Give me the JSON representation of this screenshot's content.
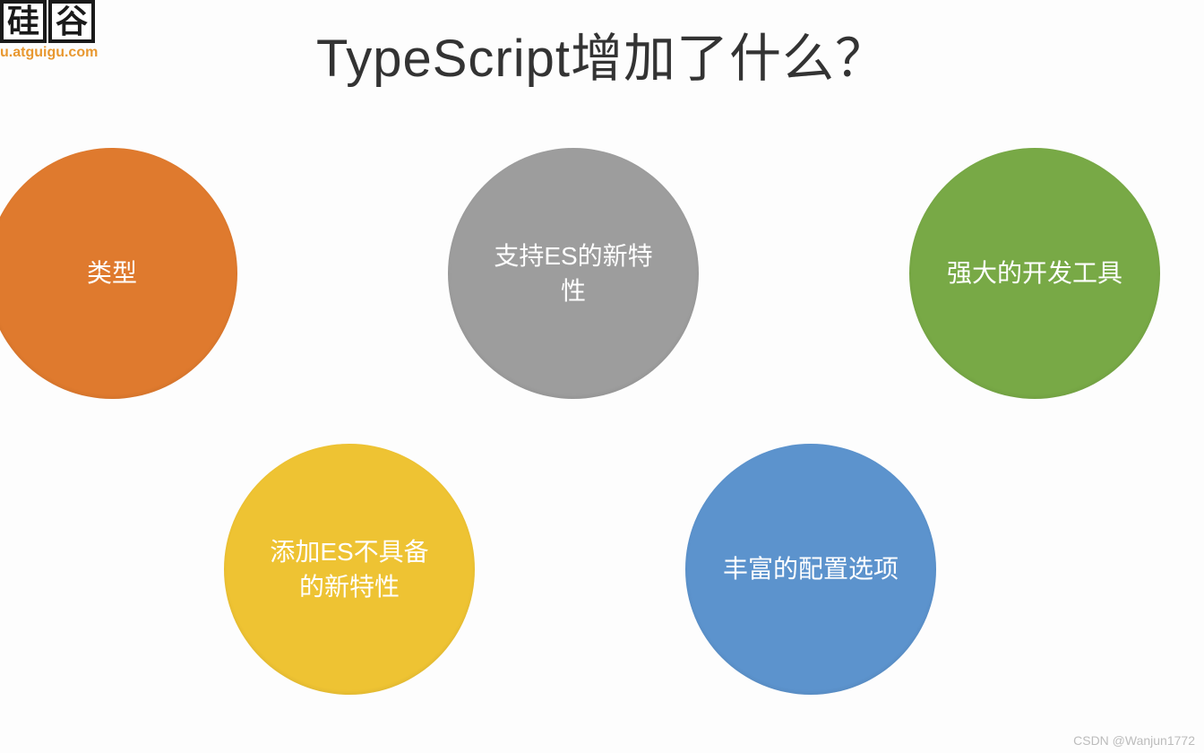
{
  "logo": {
    "char1": "硅",
    "char2": "谷",
    "url": "u.atguigu.com"
  },
  "title": "TypeScript增加了什么？",
  "circles": {
    "orange": "类型",
    "gray": "支持ES的新特性",
    "green": "强大的开发工具",
    "yellow": "添加ES不具备的新特性",
    "blue": "丰富的配置选项"
  },
  "watermark": "CSDN @Wanjun1772"
}
